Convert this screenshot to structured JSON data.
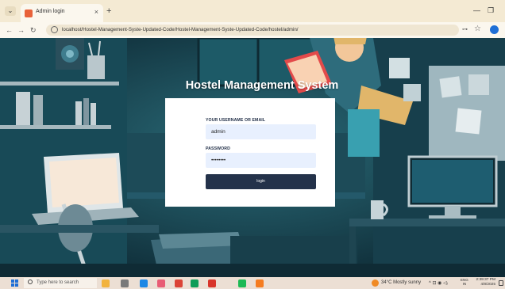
{
  "browser": {
    "tab_title": "Admin login",
    "tab_close": "×",
    "new_tab": "+",
    "url": "localhost/Hostel-Management-Syste-Updated-Code/Hostel-Management-Syste-Updated-Code/hostel/admin/",
    "icons": [
      "dropdown-icon",
      "favicon-icon",
      "back-icon",
      "forward-icon",
      "reload-icon",
      "site-info-icon",
      "extensions-icon",
      "star-icon",
      "profile-icon",
      "minimize-icon",
      "maximize-icon"
    ]
  },
  "page": {
    "title": "Hostel Management System"
  },
  "login": {
    "username_label": "YOUR USERNAME OR EMAIL",
    "username_value": "admin",
    "password_label": "PASSWORD",
    "password_value": "••••••••",
    "button_label": "login"
  },
  "taskbar": {
    "search_placeholder": "Type here to search",
    "weather": "34°C  Mostly sunny",
    "lang_top": "ENG",
    "lang_bottom": "IN",
    "time": "2:39:37 PM",
    "date": "4/8/2025",
    "tray_symbols": "^  ⊡  ◉  ◁ᵢ",
    "apps": [
      "explorer-icon",
      "task-view-icon",
      "edge-icon",
      "photos-icon",
      "chrome-icon",
      "store-icon",
      "office-icon",
      "spotify-icon",
      "xampp-icon"
    ],
    "app_colors": [
      "#f2b33d",
      "#7a7a7a",
      "#1e88e5",
      "#e85d75",
      "#db4437",
      "#0f9d58",
      "#d8342a",
      "#1db954",
      "#f57c20"
    ]
  },
  "colors": {
    "accent": "#24324a",
    "input_bg": "#e8f0fe",
    "scene_bg": "#143844"
  }
}
